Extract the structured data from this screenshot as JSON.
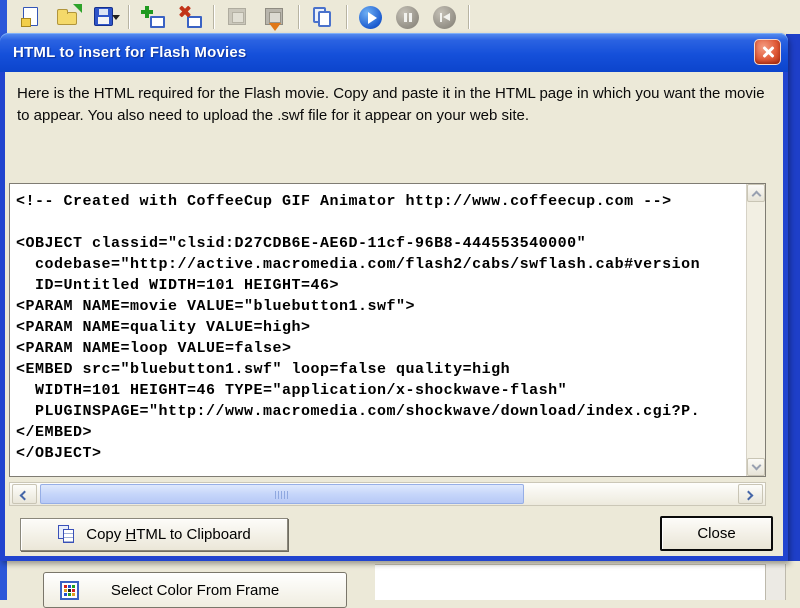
{
  "colors": {
    "dialog_face": "#ECE9D8",
    "titlebar_blue": "#1550DA",
    "window_border_blue": "#2144CF",
    "close_button_red": "#E05A38",
    "scroll_thumb_blue": "#C6D6FA"
  },
  "toolbar": {
    "icons": [
      "new-file-icon",
      "open-file-icon",
      "save-icon",
      "save-dropdown-arrow",
      "add-frame-icon",
      "delete-frame-icon",
      "frame-properties-icon",
      "export-movie-icon",
      "duplicate-frame-icon",
      "play-icon",
      "pause-icon",
      "go-to-first-frame-icon"
    ]
  },
  "dialog": {
    "title": "HTML to insert for Flash Movies",
    "close_icon": "close-icon",
    "instructions": "Here is the HTML required for the Flash movie. Copy and paste it in the HTML page in which you want the movie to appear. You also need to upload the .swf file for it appear on your web site.",
    "code": {
      "lines": [
        "<!-- Created with CoffeeCup GIF Animator http://www.coffeecup.com -->",
        "",
        "<OBJECT classid=\"clsid:D27CDB6E-AE6D-11cf-96B8-444553540000\"",
        "  codebase=\"http://active.macromedia.com/flash2/cabs/swflash.cab#version",
        "  ID=Untitled WIDTH=101 HEIGHT=46>",
        "<PARAM NAME=movie VALUE=\"bluebutton1.swf\">",
        "<PARAM NAME=quality VALUE=high>",
        "<PARAM NAME=loop VALUE=false>",
        "<EMBED src=\"bluebutton1.swf\" loop=false quality=high",
        "  WIDTH=101 HEIGHT=46 TYPE=\"application/x-shockwave-flash\"",
        "  PLUGINSPAGE=\"http://www.macromedia.com/shockwave/download/index.cgi?P.",
        "</EMBED>",
        "</OBJECT>"
      ]
    },
    "buttons": {
      "copy_pre": "Copy ",
      "copy_mnemonic": "H",
      "copy_post": "TML to Clipboard",
      "copy_icon": "copy-to-clipboard-icon",
      "close": "Close"
    }
  },
  "background_app": {
    "select_color_button": "Select Color From Frame",
    "select_color_icon": "color-palette-icon"
  }
}
